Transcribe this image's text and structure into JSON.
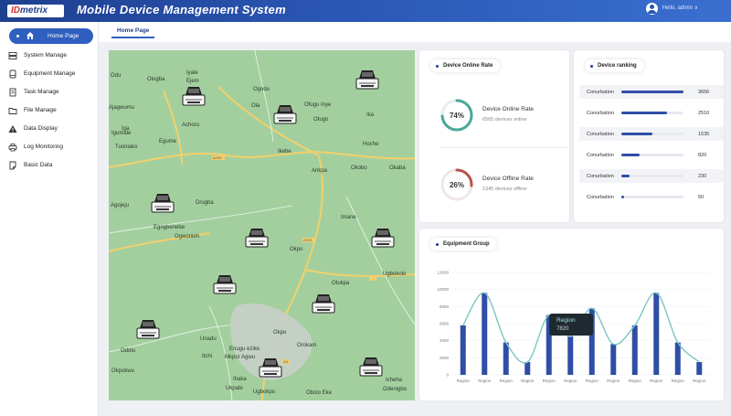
{
  "header": {
    "logo_prefix": "ID",
    "logo_suffix": "metrix",
    "title": "Mobile Device Management System",
    "user_text": "Hello, admin ∨"
  },
  "sidebar": {
    "items": [
      {
        "label": "Home Page",
        "icon": "home-icon",
        "active": true
      },
      {
        "label": "System Manage",
        "icon": "server-icon"
      },
      {
        "label": "Equipment Manage",
        "icon": "device-icon"
      },
      {
        "label": "Task Manage",
        "icon": "document-icon"
      },
      {
        "label": "File Manage",
        "icon": "folder-icon"
      },
      {
        "label": "Data Display",
        "icon": "warning-icon"
      },
      {
        "label": "Log Monitoring",
        "icon": "printer-icon"
      },
      {
        "label": "Basic Data",
        "icon": "note-icon"
      }
    ]
  },
  "tabs": [
    {
      "label": "Home Page"
    }
  ],
  "map": {
    "places": [
      "Odu",
      "Ologba",
      "Iyale",
      "Ejem",
      "Ajagwumu",
      "Achoru",
      "Ogodu",
      "Ola",
      "Ofugu Inye",
      "Otugo",
      "Ika",
      "Iga",
      "Igumale",
      "Egume",
      "Ikebe",
      "Tuoniako",
      "Hoche",
      "Ankpa",
      "Okobo",
      "Okaba",
      "Agojeju",
      "Drugba",
      "Egogbenebe",
      "Ogwonieh",
      "Imane",
      "Okpo",
      "Ugbokolo",
      "Otukpa",
      "Unadu",
      "Okpo",
      "Itchi",
      "Enugu ezike",
      "Mkpor Agwu",
      "Orokam",
      "Ihaka",
      "Odolu",
      "Ukpabi",
      "Obolo Eke",
      "Icheha",
      "Odenigbo",
      "Okpokwu",
      "Ugbokpo"
    ],
    "roads": [
      "A233",
      "A233",
      "A3"
    ]
  },
  "online_rate": {
    "title": "Device Online Rate",
    "online": {
      "percent_text": "74%",
      "percent": 74,
      "label": "Device Online Rate",
      "sub": "6565 devices online",
      "color": "#4aa89a"
    },
    "offline": {
      "percent_text": "26%",
      "percent": 26,
      "label": "Device Offline Rate",
      "sub": "1345 devices offline",
      "color": "#b8524e"
    }
  },
  "ranking": {
    "title": "Device ranking",
    "rows": [
      {
        "name": "Conurbation",
        "value": "3656",
        "fraction": 1.0
      },
      {
        "name": "Conurbation",
        "value": "2510",
        "fraction": 0.74
      },
      {
        "name": "Conurbation",
        "value": "1535",
        "fraction": 0.5
      },
      {
        "name": "Conurbation",
        "value": "820",
        "fraction": 0.3
      },
      {
        "name": "Conurbation",
        "value": "230",
        "fraction": 0.13
      },
      {
        "name": "Conurbation",
        "value": "50",
        "fraction": 0.05
      }
    ]
  },
  "equipment_group": {
    "title": "Equipment Group",
    "tooltip": {
      "name": "Region",
      "value": "7820"
    }
  },
  "chart_data": {
    "type": "bar",
    "title": "Equipment Group",
    "y_ticks": [
      "12000",
      "10000",
      "8000",
      "6000",
      "4000",
      "2000",
      "0"
    ],
    "ylim": [
      0,
      12000
    ],
    "categories": [
      "Region",
      "Region",
      "Region",
      "Region",
      "Region",
      "Region",
      "Region",
      "Region",
      "Region",
      "Region",
      "Region",
      "Region"
    ],
    "series": [
      {
        "type": "bar",
        "values": [
          5800,
          9600,
          3800,
          1500,
          7000,
          4500,
          7800,
          3600,
          5800,
          9600,
          3800,
          1500
        ],
        "color": "#2f4fa6"
      },
      {
        "type": "line",
        "smooth": true,
        "values": [
          5800,
          9600,
          3800,
          1500,
          7000,
          4500,
          7800,
          3600,
          5800,
          9600,
          3800,
          1500
        ],
        "color": "#7cc7c0"
      }
    ]
  }
}
